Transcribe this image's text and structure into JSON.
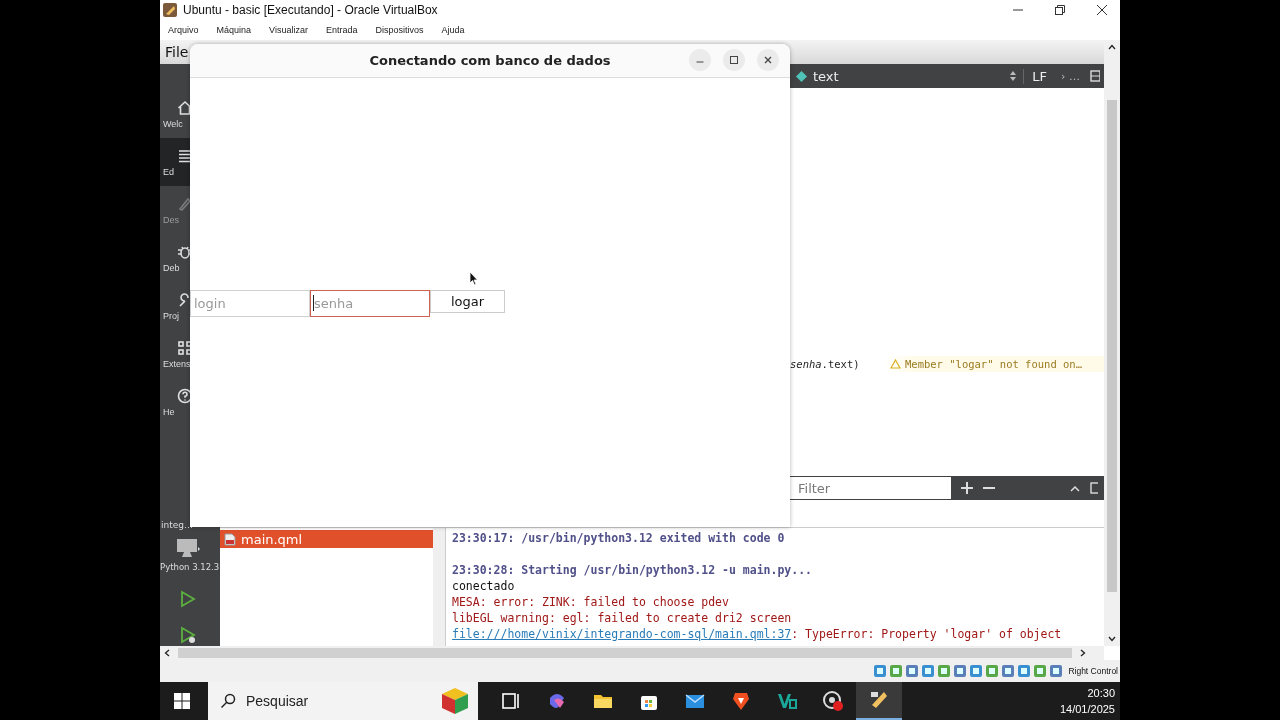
{
  "vbox_window": {
    "title": "Ubuntu - basic [Executando] - Oracle VirtualBox",
    "menu": [
      "Arquivo",
      "Máquina",
      "Visualizar",
      "Entrada",
      "Dispositivos",
      "Ajuda"
    ]
  },
  "qt_creator": {
    "menu": [
      "File"
    ],
    "modes": [
      {
        "label": "Welc",
        "kind": "home",
        "selected": false,
        "disabled": false
      },
      {
        "label": "Ed",
        "kind": "edit",
        "selected": true,
        "disabled": false
      },
      {
        "label": "Des",
        "kind": "design",
        "selected": false,
        "disabled": true
      },
      {
        "label": "Deb",
        "kind": "debug",
        "selected": false,
        "disabled": false
      },
      {
        "label": "Proj",
        "kind": "projects",
        "selected": false,
        "disabled": false
      },
      {
        "label": "Extens",
        "kind": "extensions",
        "selected": false,
        "disabled": false
      },
      {
        "label": "He",
        "kind": "help",
        "selected": false,
        "disabled": false
      }
    ],
    "project": "integ…",
    "kit": "Python 3.12.3",
    "editor": {
      "symbol": "text",
      "line_ending": "LF",
      "more": "› …",
      "code": "*senha*.text)",
      "warning": "Member \"logar\" not found on…",
      "filter": {
        "placeholder": "Filter"
      }
    },
    "files": [
      {
        "name": "main.qml",
        "selected": true
      }
    ],
    "output": [
      {
        "kind": "status",
        "text": "23:30:17: /usr/bin/python3.12 exited with code 0"
      },
      {
        "kind": "status",
        "text": "23:30:28: Starting /usr/bin/python3.12 -u main.py..."
      },
      {
        "kind": "plain",
        "text": "conectado"
      },
      {
        "kind": "error",
        "text": "MESA: error: ZINK: failed to choose pdev"
      },
      {
        "kind": "error",
        "text": "libEGL warning: egl: failed to create dri2 screen"
      },
      {
        "kind": "link",
        "link": "file:///home/vinix/integrando-com-sql/main.qml:37",
        "text": ": TypeError: Property 'logar' of object"
      }
    ]
  },
  "dialog": {
    "title": "Conectando com banco de dados",
    "fields": [
      {
        "placeholder": "login",
        "focused": false
      },
      {
        "placeholder": "senha",
        "focused": true
      }
    ],
    "button": "logar"
  },
  "status_bar": {
    "host_key": "Right Control"
  },
  "taskbar": {
    "search": {
      "placeholder": "Pesquisar"
    },
    "apps": [
      {
        "kind": "taskview",
        "active": false
      },
      {
        "kind": "swirl",
        "active": false
      },
      {
        "kind": "folder",
        "active": false
      },
      {
        "kind": "store",
        "active": false
      },
      {
        "kind": "mail",
        "active": false
      },
      {
        "kind": "shield",
        "active": false
      },
      {
        "kind": "letter",
        "active": false
      },
      {
        "kind": "record",
        "active": false
      },
      {
        "kind": "vbox",
        "active": true
      }
    ],
    "time": "20:30",
    "date": "14/01/2025"
  }
}
